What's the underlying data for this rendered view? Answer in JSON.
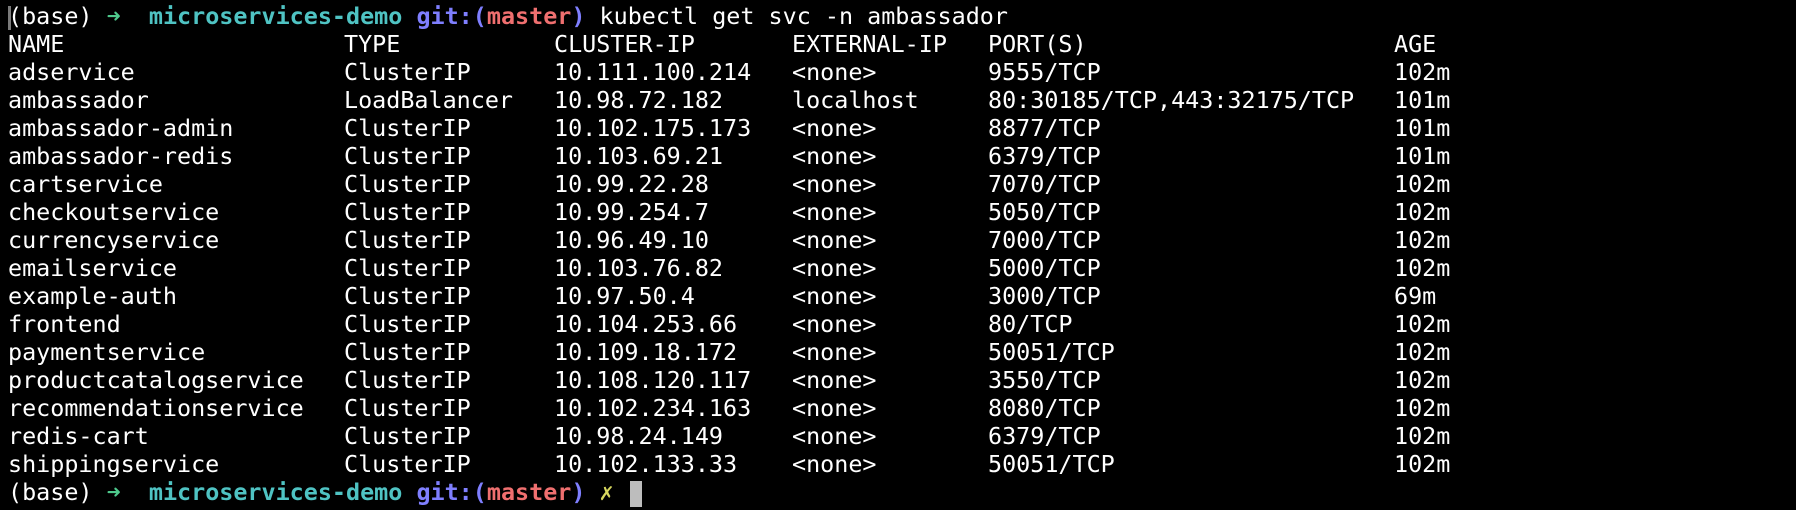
{
  "colors": {
    "background": "#000000",
    "text": "#ffffff",
    "arrow": "#4ec98c",
    "directory": "#4fc3c3",
    "git_label": "#7f7fff",
    "branch": "#ef6f6f",
    "dirty": "#d7d75f",
    "cursor": "#bdbdbd"
  },
  "prompt1": {
    "env": "(base)",
    "arrow": "➜",
    "dir": "microservices-demo",
    "git_open": "git:(",
    "branch": "master",
    "git_close": ")",
    "command": "kubectl get svc -n ambassador"
  },
  "table": {
    "headers": {
      "name": "NAME",
      "type": "TYPE",
      "cluster_ip": "CLUSTER-IP",
      "external_ip": "EXTERNAL-IP",
      "ports": "PORT(S)",
      "age": "AGE"
    },
    "rows": [
      {
        "name": "adservice",
        "type": "ClusterIP",
        "cluster_ip": "10.111.100.214",
        "external_ip": "<none>",
        "ports": "9555/TCP",
        "age": "102m"
      },
      {
        "name": "ambassador",
        "type": "LoadBalancer",
        "cluster_ip": "10.98.72.182",
        "external_ip": "localhost",
        "ports": "80:30185/TCP,443:32175/TCP",
        "age": "101m"
      },
      {
        "name": "ambassador-admin",
        "type": "ClusterIP",
        "cluster_ip": "10.102.175.173",
        "external_ip": "<none>",
        "ports": "8877/TCP",
        "age": "101m"
      },
      {
        "name": "ambassador-redis",
        "type": "ClusterIP",
        "cluster_ip": "10.103.69.21",
        "external_ip": "<none>",
        "ports": "6379/TCP",
        "age": "101m"
      },
      {
        "name": "cartservice",
        "type": "ClusterIP",
        "cluster_ip": "10.99.22.28",
        "external_ip": "<none>",
        "ports": "7070/TCP",
        "age": "102m"
      },
      {
        "name": "checkoutservice",
        "type": "ClusterIP",
        "cluster_ip": "10.99.254.7",
        "external_ip": "<none>",
        "ports": "5050/TCP",
        "age": "102m"
      },
      {
        "name": "currencyservice",
        "type": "ClusterIP",
        "cluster_ip": "10.96.49.10",
        "external_ip": "<none>",
        "ports": "7000/TCP",
        "age": "102m"
      },
      {
        "name": "emailservice",
        "type": "ClusterIP",
        "cluster_ip": "10.103.76.82",
        "external_ip": "<none>",
        "ports": "5000/TCP",
        "age": "102m"
      },
      {
        "name": "example-auth",
        "type": "ClusterIP",
        "cluster_ip": "10.97.50.4",
        "external_ip": "<none>",
        "ports": "3000/TCP",
        "age": "69m"
      },
      {
        "name": "frontend",
        "type": "ClusterIP",
        "cluster_ip": "10.104.253.66",
        "external_ip": "<none>",
        "ports": "80/TCP",
        "age": "102m"
      },
      {
        "name": "paymentservice",
        "type": "ClusterIP",
        "cluster_ip": "10.109.18.172",
        "external_ip": "<none>",
        "ports": "50051/TCP",
        "age": "102m"
      },
      {
        "name": "productcatalogservice",
        "type": "ClusterIP",
        "cluster_ip": "10.108.120.117",
        "external_ip": "<none>",
        "ports": "3550/TCP",
        "age": "102m"
      },
      {
        "name": "recommendationservice",
        "type": "ClusterIP",
        "cluster_ip": "10.102.234.163",
        "external_ip": "<none>",
        "ports": "8080/TCP",
        "age": "102m"
      },
      {
        "name": "redis-cart",
        "type": "ClusterIP",
        "cluster_ip": "10.98.24.149",
        "external_ip": "<none>",
        "ports": "6379/TCP",
        "age": "102m"
      },
      {
        "name": "shippingservice",
        "type": "ClusterIP",
        "cluster_ip": "10.102.133.33",
        "external_ip": "<none>",
        "ports": "50051/TCP",
        "age": "102m"
      }
    ]
  },
  "prompt2": {
    "env": "(base)",
    "arrow": "➜",
    "dir": "microservices-demo",
    "git_open": "git:(",
    "branch": "master",
    "git_close": ")",
    "dirty_mark": "✗"
  }
}
